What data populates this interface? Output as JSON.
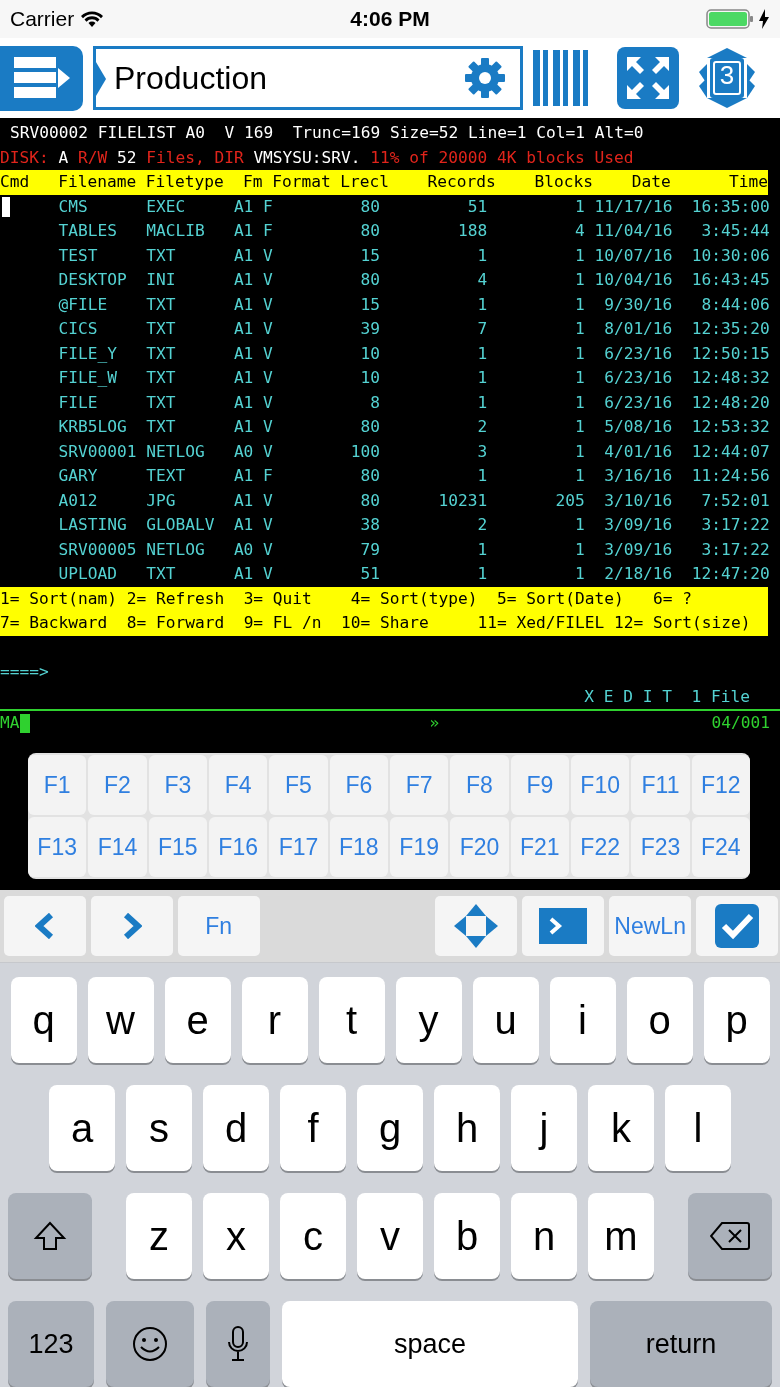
{
  "status_bar": {
    "carrier": "Carrier",
    "time": "4:06 PM",
    "charging": true
  },
  "toolbar": {
    "session_name": "Production",
    "session_count": "3"
  },
  "terminal": {
    "title_line": "SRV00002 FILELIST A0  V 169  Trunc=169 Size=52 Line=1 Col=1 Alt=0",
    "disk_line": [
      {
        "text": "DISK:",
        "color": "#e0241b"
      },
      {
        "text": "A",
        "color": "#ffffff"
      },
      {
        "text": "R/W",
        "color": "#e0241b"
      },
      {
        "text": "52",
        "color": "#ffffff"
      },
      {
        "text": "Files, DIR",
        "color": "#e0241b"
      },
      {
        "text": "VMSYSU:SRV.",
        "color": "#ffffff"
      },
      {
        "text": "11% of 20000 4K blocks Used",
        "color": "#e0241b"
      }
    ],
    "columns": [
      "Cmd",
      "Filename",
      "Filetype",
      "Fm",
      "Format",
      "Lrecl",
      "Records",
      "Blocks",
      "Date",
      "Time"
    ],
    "rows": [
      {
        "cursor": true,
        "filename": "CMS",
        "filetype": "EXEC",
        "fm": "A1",
        "format": "F",
        "lrecl": "80",
        "records": "51",
        "blocks": "1",
        "date": "11/17/16",
        "time": "16:35:00"
      },
      {
        "cursor": false,
        "filename": "TABLES",
        "filetype": "MACLIB",
        "fm": "A1",
        "format": "F",
        "lrecl": "80",
        "records": "188",
        "blocks": "4",
        "date": "11/04/16",
        "time": "3:45:44"
      },
      {
        "cursor": false,
        "filename": "TEST",
        "filetype": "TXT",
        "fm": "A1",
        "format": "V",
        "lrecl": "15",
        "records": "1",
        "blocks": "1",
        "date": "10/07/16",
        "time": "10:30:06"
      },
      {
        "cursor": false,
        "filename": "DESKTOP",
        "filetype": "INI",
        "fm": "A1",
        "format": "V",
        "lrecl": "80",
        "records": "4",
        "blocks": "1",
        "date": "10/04/16",
        "time": "16:43:45"
      },
      {
        "cursor": false,
        "filename": "@FILE",
        "filetype": "TXT",
        "fm": "A1",
        "format": "V",
        "lrecl": "15",
        "records": "1",
        "blocks": "1",
        "date": "9/30/16",
        "time": "8:44:06"
      },
      {
        "cursor": false,
        "filename": "CICS",
        "filetype": "TXT",
        "fm": "A1",
        "format": "V",
        "lrecl": "39",
        "records": "7",
        "blocks": "1",
        "date": "8/01/16",
        "time": "12:35:20"
      },
      {
        "cursor": false,
        "filename": "FILE_Y",
        "filetype": "TXT",
        "fm": "A1",
        "format": "V",
        "lrecl": "10",
        "records": "1",
        "blocks": "1",
        "date": "6/23/16",
        "time": "12:50:15"
      },
      {
        "cursor": false,
        "filename": "FILE_W",
        "filetype": "TXT",
        "fm": "A1",
        "format": "V",
        "lrecl": "10",
        "records": "1",
        "blocks": "1",
        "date": "6/23/16",
        "time": "12:48:32"
      },
      {
        "cursor": false,
        "filename": "FILE",
        "filetype": "TXT",
        "fm": "A1",
        "format": "V",
        "lrecl": "8",
        "records": "1",
        "blocks": "1",
        "date": "6/23/16",
        "time": "12:48:20"
      },
      {
        "cursor": false,
        "filename": "KRB5LOG",
        "filetype": "TXT",
        "fm": "A1",
        "format": "V",
        "lrecl": "80",
        "records": "2",
        "blocks": "1",
        "date": "5/08/16",
        "time": "12:53:32"
      },
      {
        "cursor": false,
        "filename": "SRV00001",
        "filetype": "NETLOG",
        "fm": "A0",
        "format": "V",
        "lrecl": "100",
        "records": "3",
        "blocks": "1",
        "date": "4/01/16",
        "time": "12:44:07"
      },
      {
        "cursor": false,
        "filename": "GARY",
        "filetype": "TEXT",
        "fm": "A1",
        "format": "F",
        "lrecl": "80",
        "records": "1",
        "blocks": "1",
        "date": "3/16/16",
        "time": "11:24:56"
      },
      {
        "cursor": false,
        "filename": "A012",
        "filetype": "JPG",
        "fm": "A1",
        "format": "V",
        "lrecl": "80",
        "records": "10231",
        "blocks": "205",
        "date": "3/10/16",
        "time": "7:52:01"
      },
      {
        "cursor": false,
        "filename": "LASTING",
        "filetype": "GLOBALV",
        "fm": "A1",
        "format": "V",
        "lrecl": "38",
        "records": "2",
        "blocks": "1",
        "date": "3/09/16",
        "time": "3:17:22"
      },
      {
        "cursor": false,
        "filename": "SRV00005",
        "filetype": "NETLOG",
        "fm": "A0",
        "format": "V",
        "lrecl": "79",
        "records": "1",
        "blocks": "1",
        "date": "3/09/16",
        "time": "3:17:22"
      },
      {
        "cursor": false,
        "filename": "UPLOAD",
        "filetype": "TXT",
        "fm": "A1",
        "format": "V",
        "lrecl": "51",
        "records": "1",
        "blocks": "1",
        "date": "2/18/16",
        "time": "12:47:20"
      }
    ],
    "pf_keys": [
      [
        {
          "key": "1=",
          "label": "Sort(nam)"
        },
        {
          "key": "2=",
          "label": "Refresh"
        },
        {
          "key": "3=",
          "label": "Quit"
        },
        {
          "key": "4=",
          "label": "Sort(type)"
        },
        {
          "key": "5=",
          "label": "Sort(Date)"
        },
        {
          "key": "6=",
          "label": "?"
        }
      ],
      [
        {
          "key": "7=",
          "label": "Backward"
        },
        {
          "key": "8=",
          "label": "Forward"
        },
        {
          "key": "9=",
          "label": "FL /n"
        },
        {
          "key": "10=",
          "label": "Share"
        },
        {
          "key": "11=",
          "label": "Xed/FILEL"
        },
        {
          "key": "12=",
          "label": "Sort(size)"
        }
      ]
    ],
    "prompt": "====>",
    "mode": "X E D I T",
    "file_count": "1 File",
    "command": "MA",
    "input_cursor": true,
    "indicator": "»",
    "position": "04/001"
  },
  "function_keys": [
    "F1",
    "F2",
    "F3",
    "F4",
    "F5",
    "F6",
    "F7",
    "F8",
    "F9",
    "F10",
    "F11",
    "F12",
    "F13",
    "F14",
    "F15",
    "F16",
    "F17",
    "F18",
    "F19",
    "F20",
    "F21",
    "F22",
    "F23",
    "F24"
  ],
  "accessory_bar": [
    {
      "kind": "back"
    },
    {
      "kind": "forward"
    },
    {
      "kind": "text",
      "label": "Fn"
    },
    {
      "kind": "spacer"
    },
    {
      "kind": "arrows"
    },
    {
      "kind": "prompt"
    },
    {
      "kind": "text",
      "label": "NewLn"
    },
    {
      "kind": "done"
    }
  ],
  "keyboard": {
    "rows": [
      [
        "q",
        "w",
        "e",
        "r",
        "t",
        "y",
        "u",
        "i",
        "o",
        "p"
      ],
      [
        "a",
        "s",
        "d",
        "f",
        "g",
        "h",
        "j",
        "k",
        "l"
      ],
      [
        "z",
        "x",
        "c",
        "v",
        "b",
        "n",
        "m"
      ]
    ],
    "bottom": [
      {
        "kind": "text",
        "label": "123"
      },
      {
        "kind": "emoji"
      },
      {
        "kind": "mic"
      },
      {
        "kind": "space",
        "label": "space"
      },
      {
        "kind": "return",
        "label": "return"
      }
    ]
  }
}
